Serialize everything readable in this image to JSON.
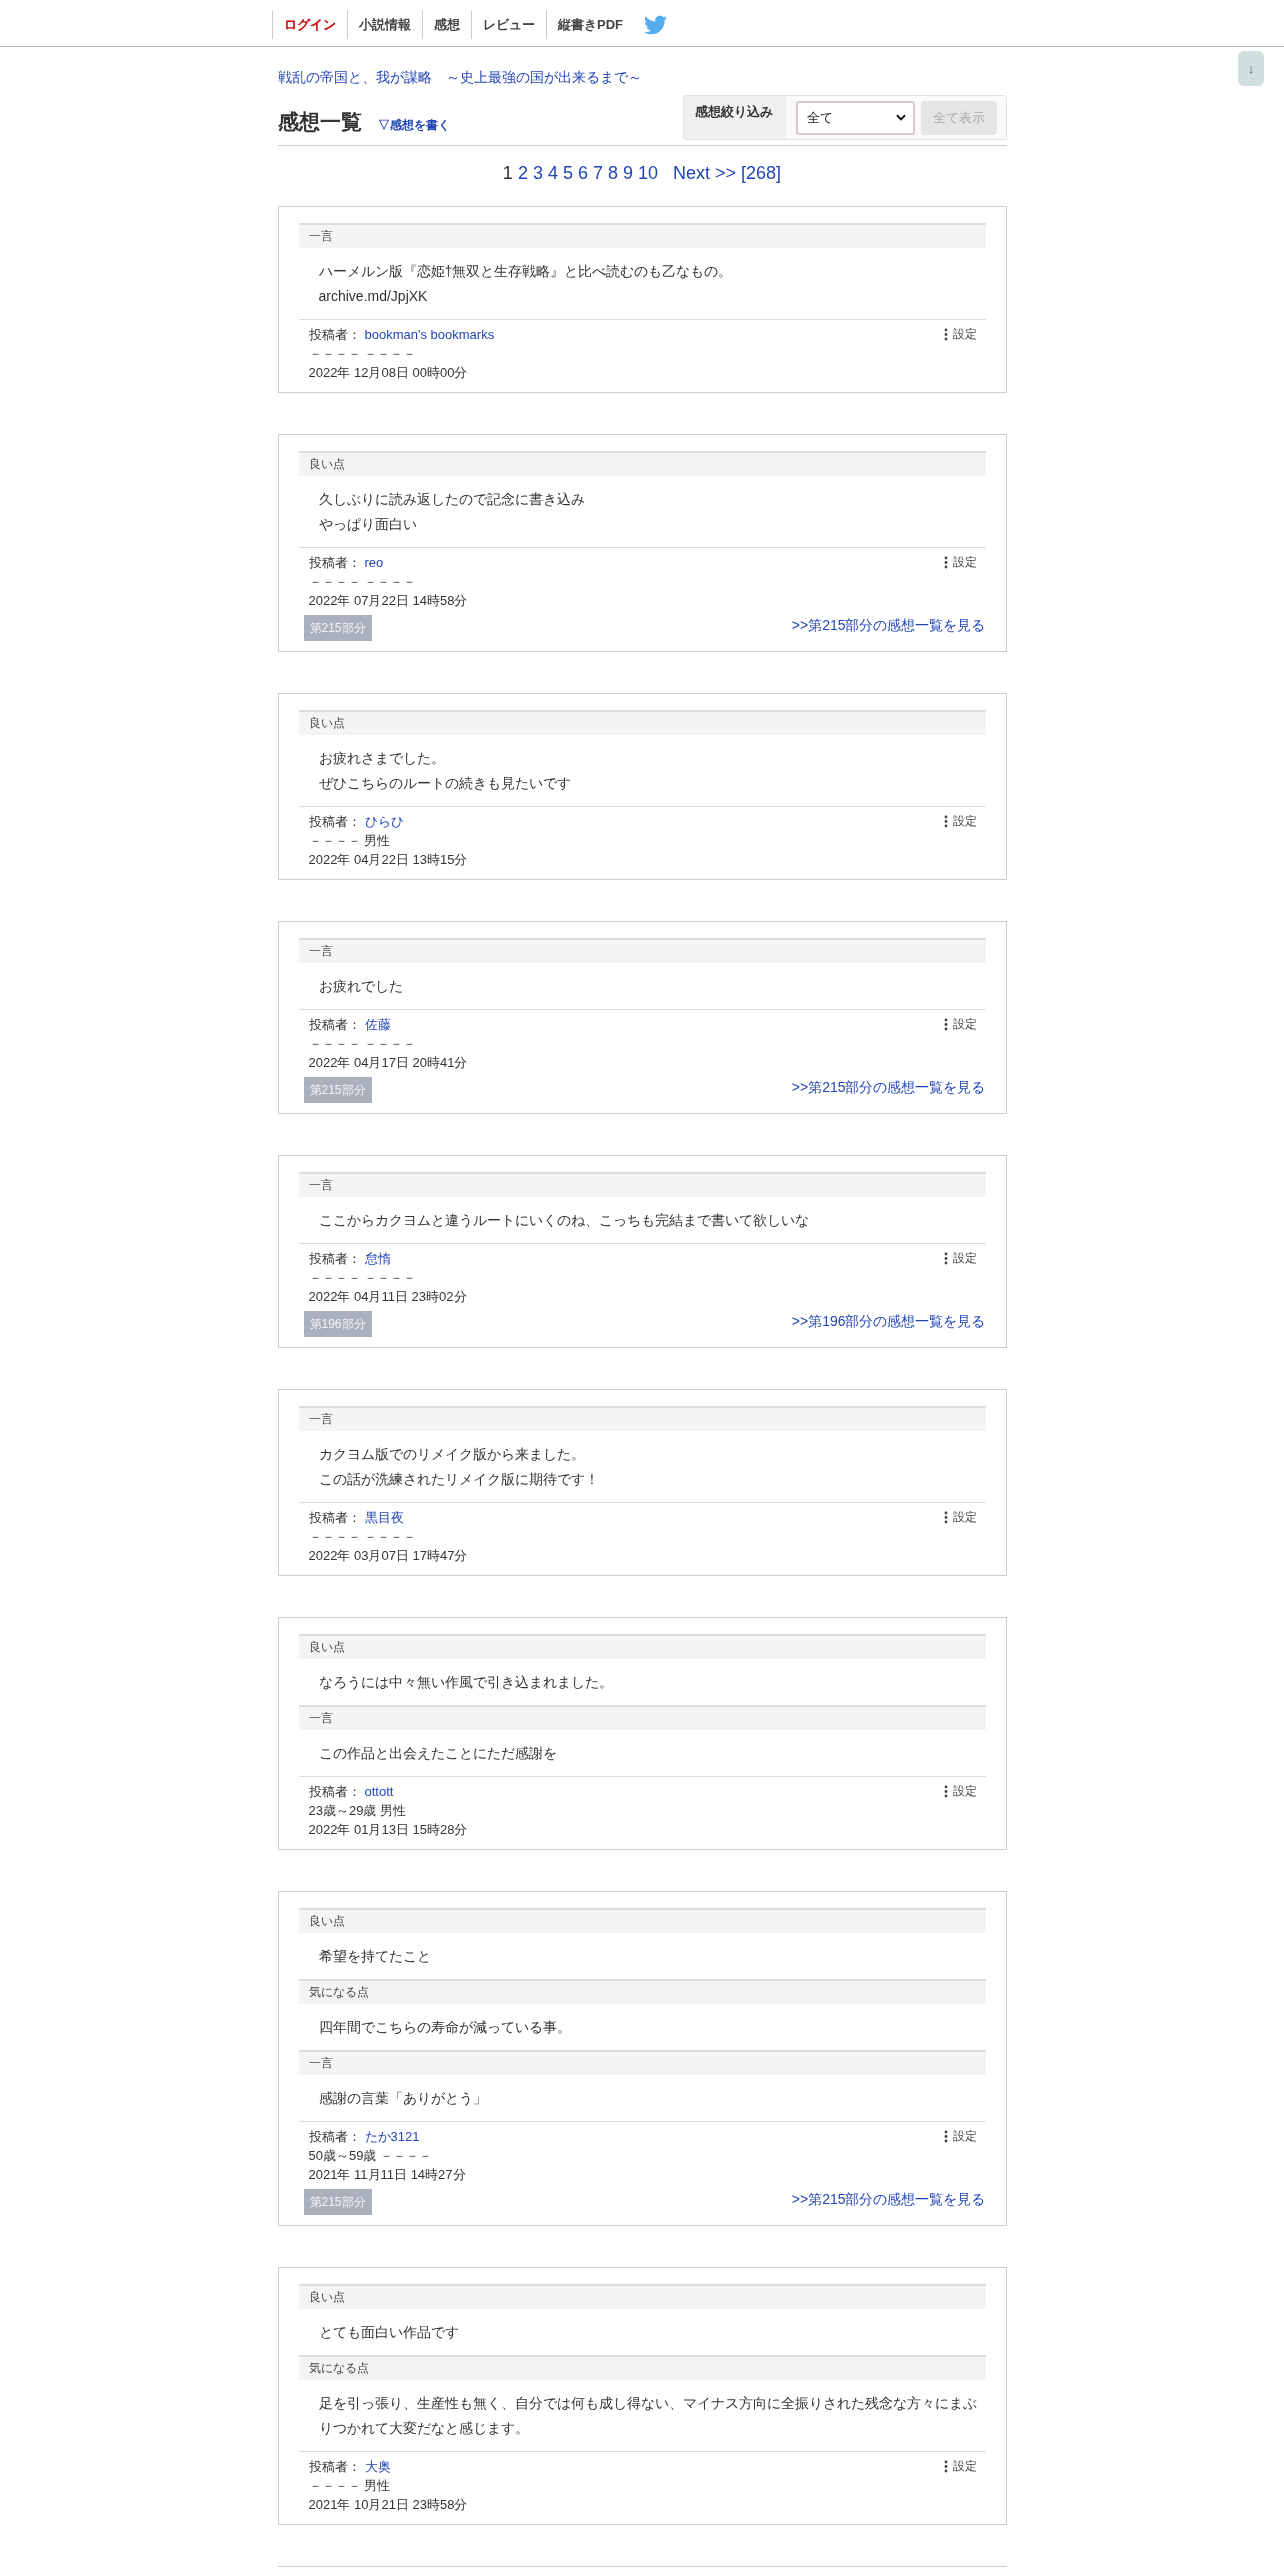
{
  "nav": [
    {
      "label": "ログイン",
      "kind": "login"
    },
    {
      "label": "小説情報",
      "kind": "link"
    },
    {
      "label": "感想",
      "kind": "link"
    },
    {
      "label": "レビュー",
      "kind": "link"
    },
    {
      "label": "縦書きPDF",
      "kind": "link"
    }
  ],
  "scroll_button": "↓",
  "novel_title": "戦乱の帝国と、我が謀略　～史上最強の国が出来るまで～",
  "heading": "感想一覧",
  "write_link": "▽感想を書く",
  "filter": {
    "label": "感想絞り込み",
    "value": "全て",
    "button": {
      "label": "全て表示",
      "disabled": true
    }
  },
  "pagination": {
    "pages": [
      {
        "label": "1",
        "selected": true
      },
      {
        "label": "2",
        "selected": false
      },
      {
        "label": "3",
        "selected": false
      },
      {
        "label": "4",
        "selected": false
      },
      {
        "label": "5",
        "selected": false
      },
      {
        "label": "6",
        "selected": false
      },
      {
        "label": "7",
        "selected": false
      },
      {
        "label": "8",
        "selected": false
      },
      {
        "label": "9",
        "selected": false
      },
      {
        "label": "10",
        "selected": false
      }
    ],
    "next": "Next >>",
    "last": "[268]"
  },
  "reviews": [
    {
      "sections": [
        {
          "label": "一言",
          "lines": [
            "ハーメルン版『恋姫†無双と生存戦略』と比べ読むのも乙なもの。",
            "archive.md/JpjXK"
          ]
        }
      ],
      "author_label": "投稿者：",
      "author": "bookman's bookmarks",
      "settings": "設定",
      "profile": "－－－－ －－－－",
      "date": "2022年 12月08日 00時00分"
    },
    {
      "sections": [
        {
          "label": "良い点",
          "lines": [
            "久しぶりに読み返したので記念に書き込み",
            "やっぱり面白い"
          ]
        }
      ],
      "author_label": "投稿者：",
      "author": "reo",
      "settings": "設定",
      "profile": "－－－－ －－－－",
      "date": "2022年 07月22日 14時58分",
      "episode": {
        "tag": "第215部分",
        "link": ">>第215部分の感想一覧を見る"
      }
    },
    {
      "sections": [
        {
          "label": "良い点",
          "lines": [
            "お疲れさまでした。",
            "ぜひこちらのルートの続きも見たいです"
          ]
        }
      ],
      "author_label": "投稿者：",
      "author": "ひらひ",
      "settings": "設定",
      "profile": "－－－－ 男性",
      "date": "2022年 04月22日 13時15分"
    },
    {
      "sections": [
        {
          "label": "一言",
          "lines": [
            "お疲れでした"
          ]
        }
      ],
      "author_label": "投稿者：",
      "author": "佐藤",
      "settings": "設定",
      "profile": "－－－－ －－－－",
      "date": "2022年 04月17日 20時41分",
      "episode": {
        "tag": "第215部分",
        "link": ">>第215部分の感想一覧を見る"
      }
    },
    {
      "sections": [
        {
          "label": "一言",
          "lines": [
            "ここからカクヨムと違うルートにいくのね、こっちも完結まで書いて欲しいな"
          ]
        }
      ],
      "author_label": "投稿者：",
      "author": "怠惰",
      "settings": "設定",
      "profile": "－－－－ －－－－",
      "date": "2022年 04月11日 23時02分",
      "episode": {
        "tag": "第196部分",
        "link": ">>第196部分の感想一覧を見る"
      }
    },
    {
      "sections": [
        {
          "label": "一言",
          "lines": [
            "カクヨム版でのリメイク版から来ました。",
            "この話が洗練されたリメイク版に期待です！"
          ]
        }
      ],
      "author_label": "投稿者：",
      "author": "黒目夜",
      "settings": "設定",
      "profile": "－－－－ －－－－",
      "date": "2022年 03月07日 17時47分"
    },
    {
      "sections": [
        {
          "label": "良い点",
          "lines": [
            "なろうには中々無い作風で引き込まれました。"
          ]
        },
        {
          "label": "一言",
          "lines": [
            "この作品と出会えたことにただ感謝を"
          ]
        }
      ],
      "author_label": "投稿者：",
      "author": "ottott",
      "settings": "設定",
      "profile": "23歳～29歳 男性",
      "date": "2022年 01月13日 15時28分"
    },
    {
      "sections": [
        {
          "label": "良い点",
          "lines": [
            "希望を持てたこと"
          ]
        },
        {
          "label": "気になる点",
          "lines": [
            "四年間でこちらの寿命が減っている事。"
          ]
        },
        {
          "label": "一言",
          "lines": [
            "感謝の言葉「ありがとう」"
          ]
        }
      ],
      "author_label": "投稿者：",
      "author": "たか3121",
      "settings": "設定",
      "profile": "50歳～59歳 －－－－",
      "date": "2021年 11月11日 14時27分",
      "episode": {
        "tag": "第215部分",
        "link": ">>第215部分の感想一覧を見る"
      }
    },
    {
      "sections": [
        {
          "label": "良い点",
          "lines": [
            "とても面白い作品です"
          ]
        },
        {
          "label": "気になる点",
          "lines": [
            "足を引っ張り、生産性も無く、自分では何も成し得ない、マイナス方向に全振りされた残念な方々にまぶりつかれて大変だなと感じます。"
          ]
        }
      ],
      "author_label": "投稿者：",
      "author": "大奥",
      "settings": "設定",
      "profile": "－－－－ 男性",
      "date": "2021年 10月21日 23時58分"
    }
  ]
}
